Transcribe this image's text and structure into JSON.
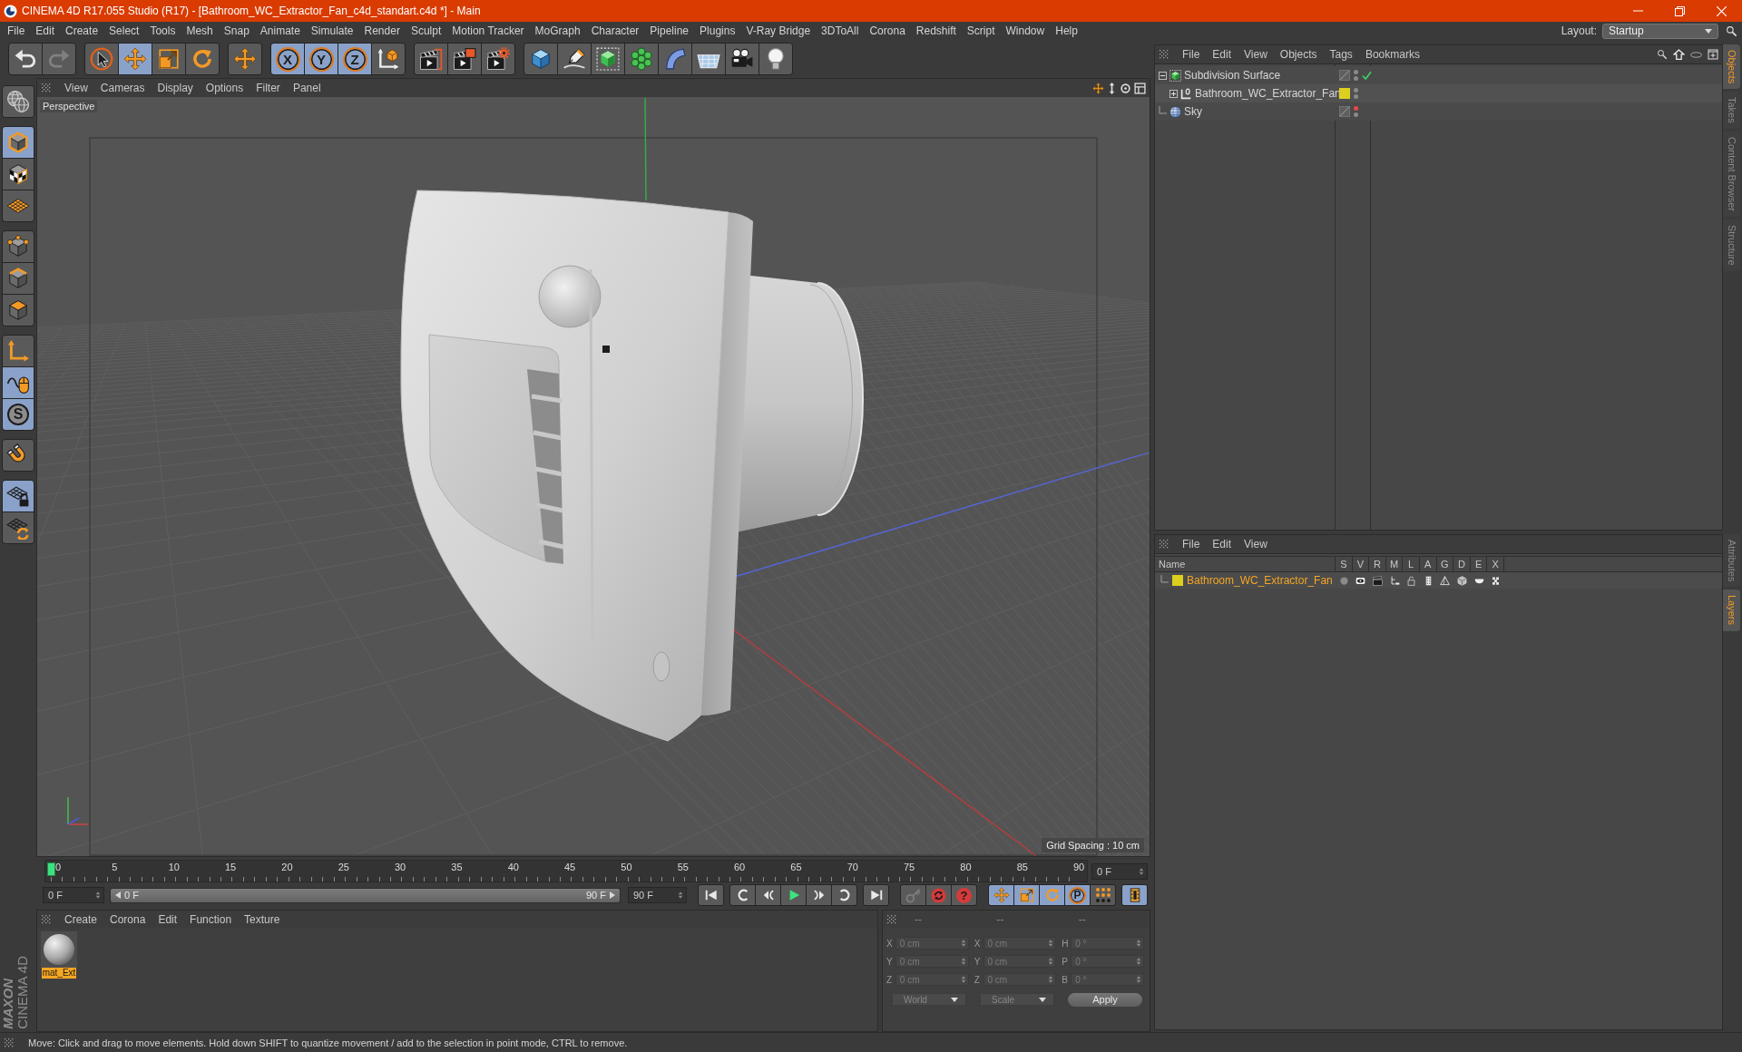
{
  "window": {
    "title": "CINEMA 4D R17.055 Studio (R17) - [Bathroom_WC_Extractor_Fan_c4d_standart.c4d *] - Main"
  },
  "menu_bar": {
    "items": [
      "File",
      "Edit",
      "Create",
      "Select",
      "Tools",
      "Mesh",
      "Snap",
      "Animate",
      "Simulate",
      "Render",
      "Sculpt",
      "Motion Tracker",
      "MoGraph",
      "Character",
      "Pipeline",
      "Plugins",
      "V-Ray Bridge",
      "3DToAll",
      "Corona",
      "Redshift",
      "Script",
      "Window",
      "Help"
    ],
    "layout_label": "Layout:",
    "layout_value": "Startup"
  },
  "main_toolbar": {
    "groups": [
      [
        {
          "active": false,
          "disabled": false
        },
        {
          "active": false,
          "disabled": true
        }
      ],
      [
        {
          "active": false,
          "disabled": false
        },
        {
          "active": true,
          "disabled": false
        },
        {
          "active": false,
          "disabled": false
        },
        {
          "active": false,
          "disabled": false
        }
      ],
      [
        {
          "active": false,
          "disabled": false
        }
      ],
      [
        {
          "label": "X",
          "active": true,
          "disabled": false
        },
        {
          "label": "Y",
          "active": true,
          "disabled": false
        },
        {
          "label": "Z",
          "active": true,
          "disabled": false
        },
        {
          "active": false,
          "disabled": false
        }
      ],
      [
        {
          "active": false,
          "disabled": false
        },
        {
          "active": false,
          "disabled": false
        },
        {
          "active": false,
          "disabled": false
        }
      ],
      [
        {
          "active": false,
          "disabled": false
        },
        {
          "active": false,
          "disabled": false
        },
        {
          "active": false,
          "disabled": false
        },
        {
          "active": false,
          "disabled": false
        },
        {
          "active": false,
          "disabled": false
        },
        {
          "active": false,
          "disabled": false
        },
        {
          "active": false,
          "disabled": false
        },
        {
          "active": false,
          "disabled": false
        }
      ]
    ]
  },
  "left_toolbar": {
    "groups": [
      [
        {
          "active": false
        }
      ],
      [
        {
          "active": true
        },
        {
          "active": false
        },
        {
          "active": false
        }
      ],
      [
        {
          "active": false
        },
        {
          "active": false
        },
        {
          "active": false
        }
      ],
      [
        {
          "active": false
        },
        {
          "active": true
        },
        {
          "label": "S",
          "active": true
        }
      ],
      [
        {
          "active": false
        }
      ],
      [
        {
          "active": true
        },
        {
          "active": false
        }
      ]
    ]
  },
  "viewport": {
    "menu": [
      "View",
      "Cameras",
      "Display",
      "Options",
      "Filter",
      "Panel"
    ],
    "camera": "Perspective",
    "grid_spacing": "Grid Spacing : 10 cm"
  },
  "timeline": {
    "ticks": [
      "0",
      "5",
      "10",
      "15",
      "20",
      "25",
      "30",
      "35",
      "40",
      "45",
      "50",
      "55",
      "60",
      "65",
      "70",
      "75",
      "80",
      "85",
      "90"
    ],
    "level": 0,
    "frame_field": "0 F"
  },
  "playback": {
    "start_field": "0 F",
    "range": {
      "start": "0 F",
      "end": "90 F",
      "level": 1
    },
    "end_field": "90 F",
    "key_buttons": [
      {
        "disabled": true
      },
      {
        "disabled": false
      },
      {
        "label": "?",
        "disabled": false
      }
    ],
    "key_modes": [
      {
        "active": true
      },
      {
        "active": true
      },
      {
        "active": true
      },
      {
        "label": "P",
        "active": true
      },
      {
        "active": false
      }
    ],
    "timeline_button": {
      "active": true
    }
  },
  "materials_panel": {
    "menu": [
      "Create",
      "Corona",
      "Edit",
      "Function",
      "Texture"
    ],
    "materials": [
      {
        "name": "mat_Ext",
        "selected": true
      }
    ]
  },
  "coordinates": {
    "disabled": true,
    "headers": [
      "--",
      "--",
      "--"
    ],
    "rows": [
      {
        "labels": [
          "X",
          "X",
          "H"
        ],
        "values": [
          "0 cm",
          "0 cm",
          "0 °"
        ]
      },
      {
        "labels": [
          "Y",
          "Y",
          "P"
        ],
        "values": [
          "0 cm",
          "0 cm",
          "0 °"
        ]
      },
      {
        "labels": [
          "Z",
          "Z",
          "B"
        ],
        "values": [
          "0 cm",
          "0 cm",
          "0 °"
        ]
      }
    ],
    "dropdowns": [
      "World",
      "Scale"
    ],
    "apply": "Apply"
  },
  "objects_panel": {
    "menu": [
      "File",
      "Edit",
      "View",
      "Objects",
      "Tags",
      "Bookmarks"
    ],
    "objects": [
      {
        "name": "Subdivision Surface",
        "has_children": true,
        "expanded": true,
        "selected": false,
        "editor_hidden": false,
        "enabled": true,
        "children": [
          {
            "name": "Bathroom_WC_Extractor_Fan",
            "has_children": true,
            "expanded": false,
            "selected": false,
            "editor_hidden": false,
            "color": "#dccf1e"
          }
        ]
      },
      {
        "name": "Sky",
        "has_children": false,
        "selected": false,
        "editor_hidden": true
      }
    ]
  },
  "layers_panel": {
    "menu": [
      "File",
      "Edit",
      "View"
    ],
    "columns": [
      "Name",
      "S",
      "V",
      "R",
      "M",
      "L",
      "A",
      "G",
      "D",
      "E",
      "X"
    ],
    "layers": [
      {
        "name": "Bathroom_WC_Extractor_Fan",
        "color": "#dccf1e",
        "selected": true
      }
    ]
  },
  "side_tabs": {
    "top": [
      {
        "label": "Objects",
        "selected": true
      },
      {
        "label": "Takes",
        "selected": false
      },
      {
        "label": "Content Browser",
        "selected": false
      },
      {
        "label": "Structure",
        "selected": false
      }
    ],
    "bottom": [
      {
        "label": "Attributes",
        "selected": false
      },
      {
        "label": "Layers",
        "selected": true
      }
    ]
  },
  "brand": {
    "lines": [
      "MAXON",
      "CINEMA 4D"
    ]
  },
  "status_bar": {
    "text": "Move: Click and drag to move elements. Hold down SHIFT to quantize movement / add to the selection in point mode, CTRL to remove."
  }
}
